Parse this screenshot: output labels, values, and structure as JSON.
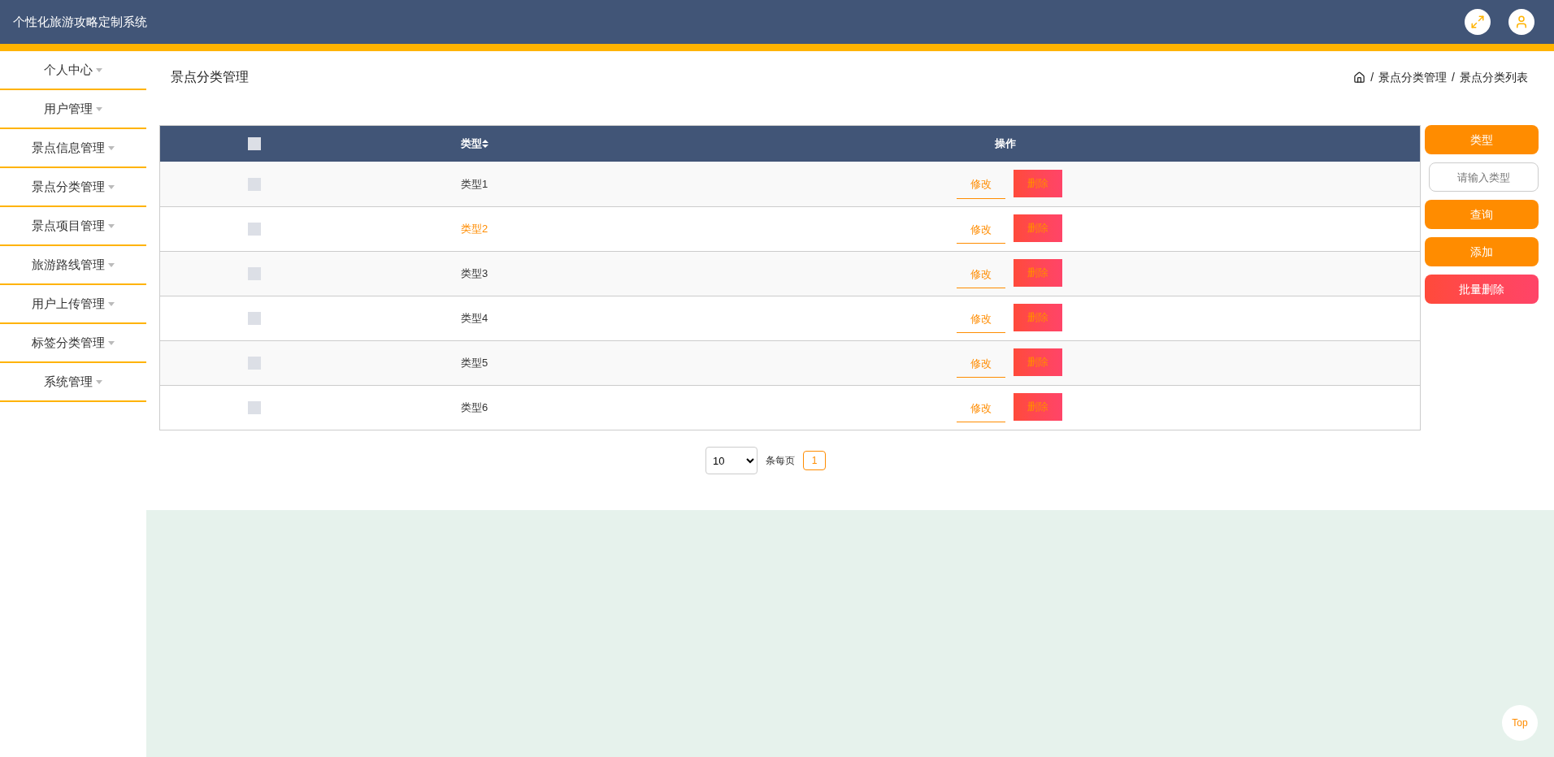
{
  "app_title": "个性化旅游攻略定制系统",
  "sidebar": {
    "items": [
      {
        "label": "个人中心"
      },
      {
        "label": "用户管理"
      },
      {
        "label": "景点信息管理"
      },
      {
        "label": "景点分类管理"
      },
      {
        "label": "景点项目管理"
      },
      {
        "label": "旅游路线管理"
      },
      {
        "label": "用户上传管理"
      },
      {
        "label": "标签分类管理"
      },
      {
        "label": "系统管理"
      }
    ]
  },
  "page_title": "景点分类管理",
  "breadcrumb": [
    {
      "separator": "/",
      "label": "景点分类管理"
    },
    {
      "separator": "/",
      "label": "景点分类列表"
    }
  ],
  "table": {
    "columns": [
      "类型",
      "操作"
    ],
    "select_all_checked": false,
    "rows": [
      {
        "type": "类型1",
        "checked": false,
        "highlighted": false,
        "actions": [
          "修改",
          "删除"
        ]
      },
      {
        "type": "类型2",
        "checked": false,
        "highlighted": true,
        "actions": [
          "修改",
          "删除"
        ]
      },
      {
        "type": "类型3",
        "checked": false,
        "highlighted": false,
        "actions": [
          "修改",
          "删除"
        ]
      },
      {
        "type": "类型4",
        "checked": false,
        "highlighted": false,
        "actions": [
          "修改",
          "删除"
        ]
      },
      {
        "type": "类型5",
        "checked": false,
        "highlighted": false,
        "actions": [
          "修改",
          "删除"
        ]
      },
      {
        "type": "类型6",
        "checked": false,
        "highlighted": false,
        "actions": [
          "修改",
          "删除"
        ]
      }
    ]
  },
  "pagination": {
    "page_size": "10",
    "per_page_label": "条每页",
    "pages": [
      {
        "label": "1",
        "selected": true
      }
    ]
  },
  "search_panel": {
    "field_label": "类型",
    "placeholder": "请输入类型",
    "buttons": [
      {
        "label": "查询",
        "kind": "primary"
      },
      {
        "label": "添加",
        "kind": "primary"
      },
      {
        "label": "批量删除",
        "kind": "danger"
      }
    ]
  },
  "back_to_top": "Top"
}
